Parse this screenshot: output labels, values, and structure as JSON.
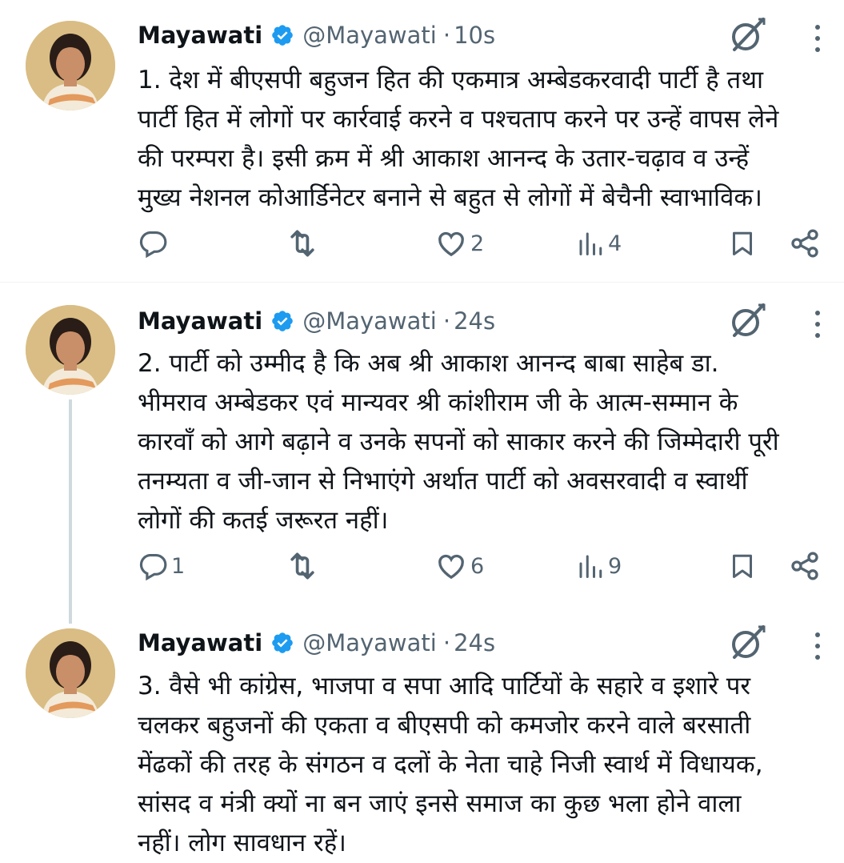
{
  "tweets": [
    {
      "name": "Mayawati",
      "handle": "@Mayawati",
      "separator": "·",
      "time": "10s",
      "text": "1. देश में बीएसपी बहुजन हित की एकमात्र अम्बेडकरवादी पार्टी है तथा\nपार्टी हित में लोगों पर कार्रवाई करने व पश्चताप करने पर उन्हें वापस लेने\nकी परम्परा है। इसी क्रम में श्री आकाश आनन्द के उतार-चढ़ाव व उन्हें\nमुख्य नेशनल कोआर्डिनेटर बनाने से बहुत से लोगों में बेचैनी स्वाभाविक।",
      "replies": "",
      "reposts": "",
      "likes": "2",
      "views": "4"
    },
    {
      "name": "Mayawati",
      "handle": "@Mayawati",
      "separator": "·",
      "time": "24s",
      "text": "2. पार्टी को उम्मीद है कि अब श्री आकाश आनन्द बाबा साहेब डा.\nभीमराव अम्बेडकर एवं मान्यवर श्री कांशीराम जी के आत्म-सम्मान के\nकारवाँ को आगे बढ़ाने व उनके सपनों को साकार करने की जिम्मेदारी पूरी\nतनम्यता व जी-जान से निभाएंगे अर्थात पार्टी को अवसरवादी व स्वार्थी\nलोगों की कतई जरूरत नहीं।",
      "replies": "1",
      "reposts": "",
      "likes": "6",
      "views": "9"
    },
    {
      "name": "Mayawati",
      "handle": "@Mayawati",
      "separator": "·",
      "time": "24s",
      "text": "3. वैसे भी कांग्रेस, भाजपा व सपा आदि पार्टियों के सहारे व इशारे पर\nचलकर बहुजनों की एकता व बीएसपी को कमजोर करने वाले बरसाती\nमेंढकों की तरह के संगठन व दलों के नेता चाहे निजी स्वार्थ में विधायक,\nसांसद व मंत्री क्यों ना बन जाएं इनसे समाज का कुछ भला होने वाला\nनहीं। लोग सावधान रहें।"
    }
  ],
  "colors": {
    "text_primary": "#0f1419",
    "text_secondary": "#536471",
    "verified_blue": "#1d9bf0",
    "divider": "#eff3f4",
    "thread_line": "#cfd9de"
  },
  "icons": {
    "verified": "verified-badge-icon",
    "grok": "grok-icon",
    "more": "more-vertical-icon",
    "reply": "reply-icon",
    "repost": "repost-icon",
    "like": "heart-icon",
    "views": "views-chart-icon",
    "bookmark": "bookmark-icon",
    "share": "share-icon"
  }
}
